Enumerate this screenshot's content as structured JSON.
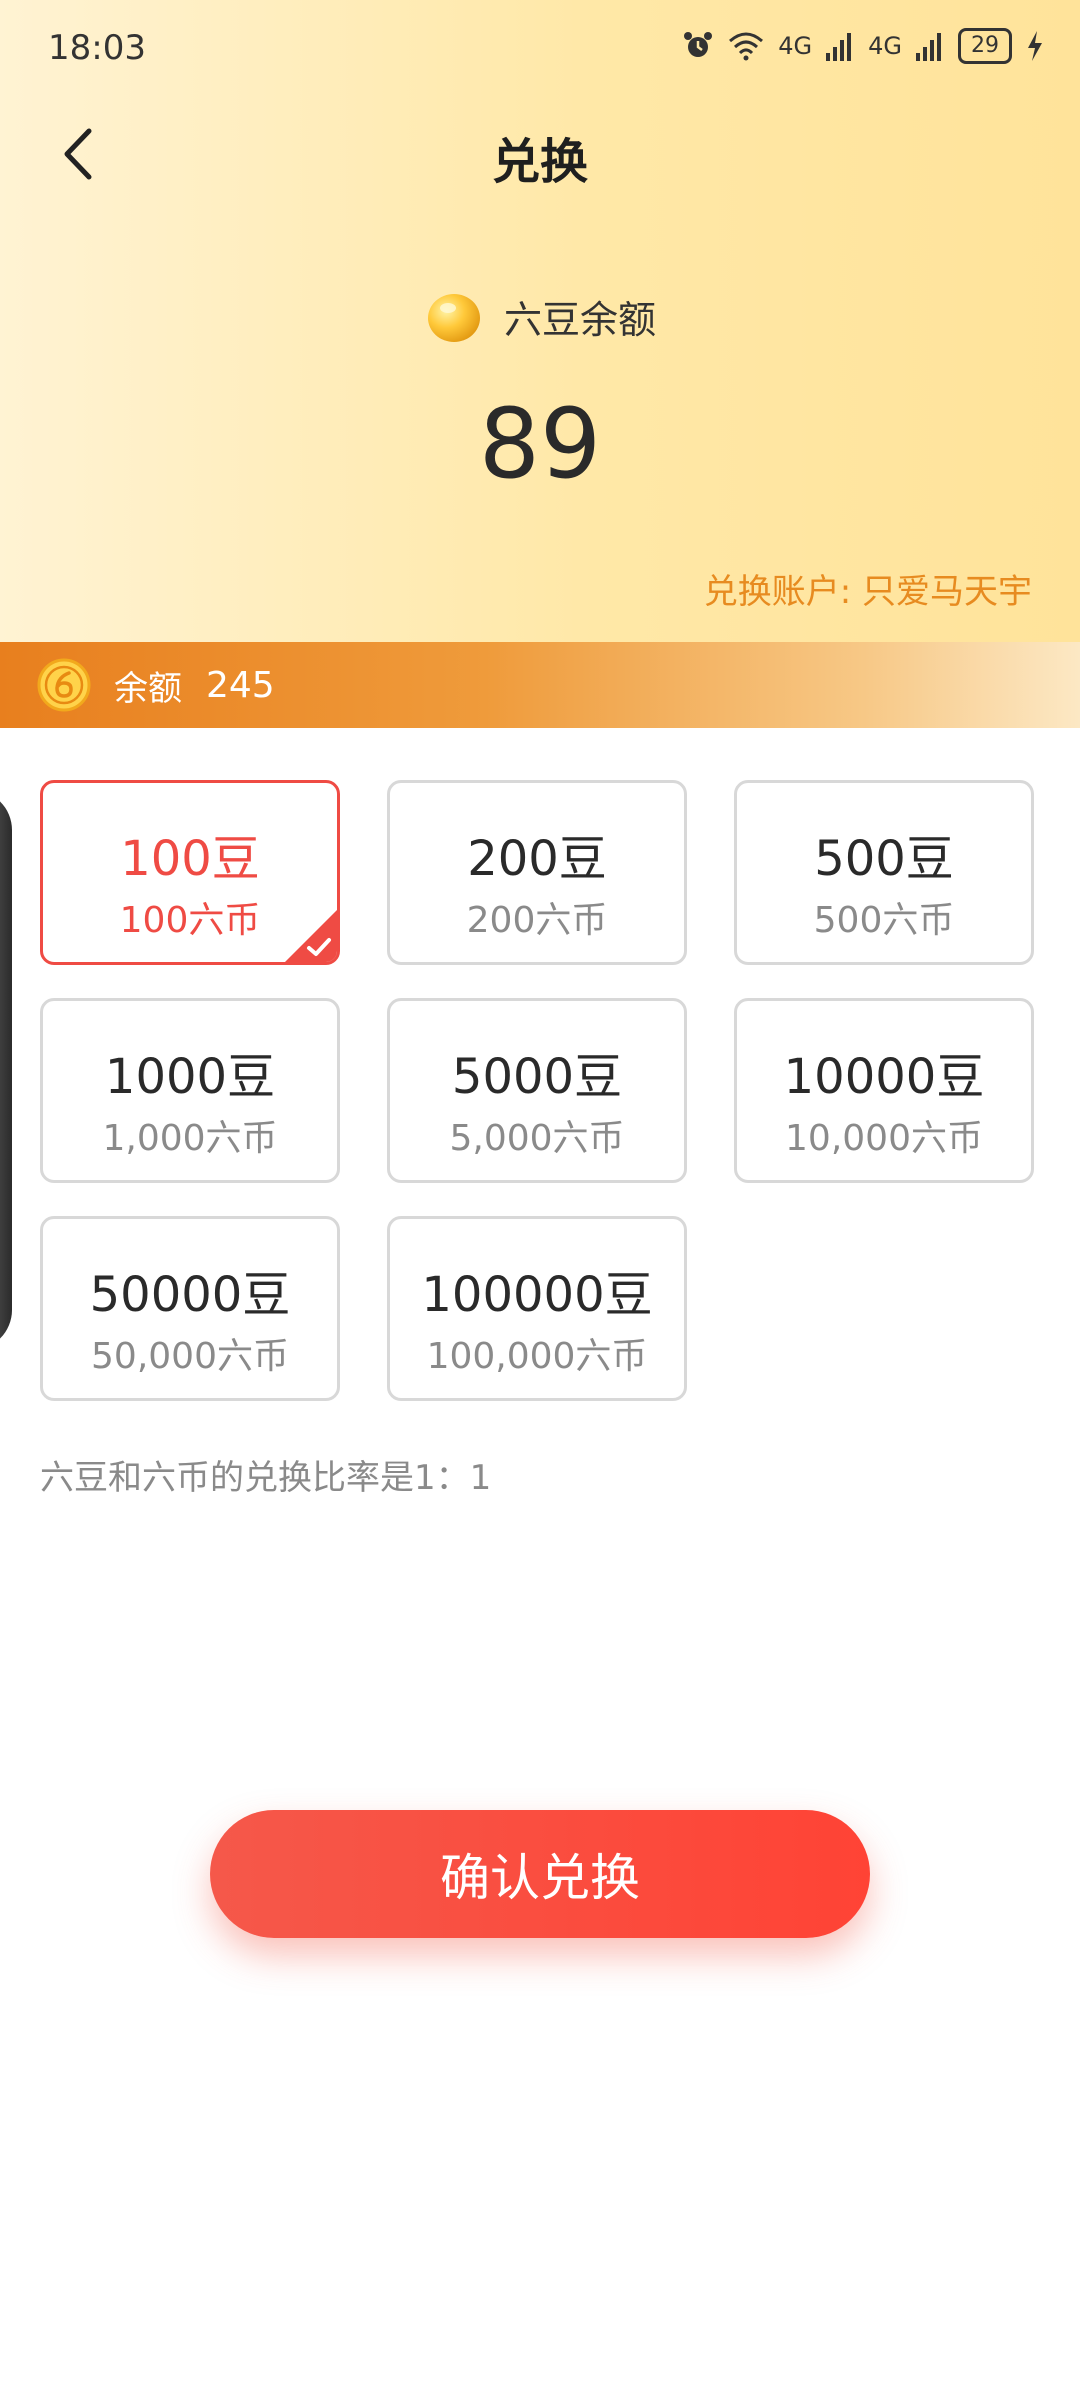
{
  "status_bar": {
    "time": "18:03",
    "network1": "4G",
    "network2": "4G",
    "battery": "29"
  },
  "header": {
    "title": "兑换"
  },
  "balance": {
    "label": "六豆余额",
    "value": "89",
    "account_prefix": "兑换账户: ",
    "account_name": "只爱马天宇"
  },
  "coin_strip": {
    "label": "余额",
    "value": "245"
  },
  "options": [
    {
      "beans": "100豆",
      "coins": "100六币",
      "selected": true
    },
    {
      "beans": "200豆",
      "coins": "200六币",
      "selected": false
    },
    {
      "beans": "500豆",
      "coins": "500六币",
      "selected": false
    },
    {
      "beans": "1000豆",
      "coins": "1,000六币",
      "selected": false
    },
    {
      "beans": "5000豆",
      "coins": "5,000六币",
      "selected": false
    },
    {
      "beans": "10000豆",
      "coins": "10,000六币",
      "selected": false
    },
    {
      "beans": "50000豆",
      "coins": "50,000六币",
      "selected": false
    },
    {
      "beans": "100000豆",
      "coins": "100,000六币",
      "selected": false
    }
  ],
  "rate_note": "六豆和六币的兑换比率是1：1",
  "confirm_label": "确认兑换",
  "colors": {
    "accent_red": "#EF4B44",
    "account_orange": "#E78B20",
    "strip_orange": "#E87F1E"
  }
}
